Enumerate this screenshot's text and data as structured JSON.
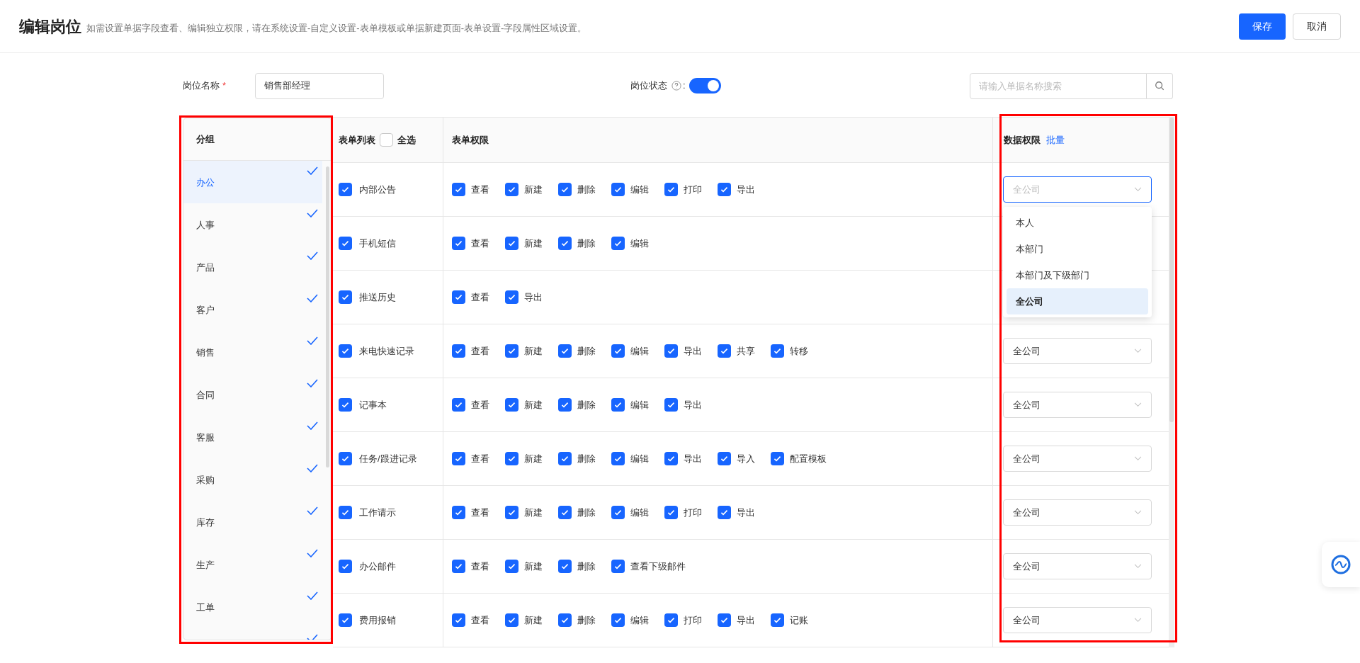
{
  "header": {
    "title": "编辑岗位",
    "hint": "如需设置单据字段查看、编辑独立权限，请在系统设置-自定义设置-表单模板或单据新建页面-表单设置-字段属性区域设置。",
    "buttons": [
      {
        "label": "保存",
        "kind": "primary"
      },
      {
        "label": "取消",
        "kind": "default"
      }
    ]
  },
  "form": {
    "name_label": "岗位名称",
    "required_mark": "*",
    "name_value": "销售部经理",
    "status_label": "岗位状态",
    "status_suffix": ":",
    "status_on": true,
    "search_placeholder": "请输入单据名称搜索"
  },
  "groups": {
    "heading": "分组",
    "items": [
      {
        "label": "办公",
        "checked": true,
        "selected": true
      },
      {
        "label": "人事",
        "checked": true,
        "selected": false
      },
      {
        "label": "产品",
        "checked": true,
        "selected": false
      },
      {
        "label": "客户",
        "checked": true,
        "selected": false
      },
      {
        "label": "销售",
        "checked": true,
        "selected": false
      },
      {
        "label": "合同",
        "checked": true,
        "selected": false
      },
      {
        "label": "客服",
        "checked": true,
        "selected": false
      },
      {
        "label": "采购",
        "checked": true,
        "selected": false
      },
      {
        "label": "库存",
        "checked": true,
        "selected": false
      },
      {
        "label": "生产",
        "checked": true,
        "selected": false
      },
      {
        "label": "工单",
        "checked": true,
        "selected": false
      },
      {
        "checked": true,
        "selected": false
      }
    ]
  },
  "table": {
    "form_heading": "表单列表",
    "select_all_label": "全选",
    "select_all_checked": false,
    "perm_heading": "表单权限",
    "data_heading": "数据权限",
    "batch_link": "批量",
    "rows": [
      {
        "name": "内部公告",
        "checked": true,
        "perms": [
          {
            "label": "查看",
            "checked": true
          },
          {
            "label": "新建",
            "checked": true
          },
          {
            "label": "删除",
            "checked": true
          },
          {
            "label": "编辑",
            "checked": true
          },
          {
            "label": "打印",
            "checked": true
          },
          {
            "label": "导出",
            "checked": true
          }
        ],
        "scope": "全公司",
        "open": true
      },
      {
        "name": "手机短信",
        "checked": true,
        "perms": [
          {
            "label": "查看",
            "checked": true
          },
          {
            "label": "新建",
            "checked": true
          },
          {
            "label": "删除",
            "checked": true
          },
          {
            "label": "编辑",
            "checked": true
          }
        ]
      },
      {
        "name": "推送历史",
        "checked": true,
        "perms": [
          {
            "label": "查看",
            "checked": true
          },
          {
            "label": "导出",
            "checked": true
          }
        ]
      },
      {
        "name": "来电快速记录",
        "checked": true,
        "perms": [
          {
            "label": "查看",
            "checked": true
          },
          {
            "label": "新建",
            "checked": true
          },
          {
            "label": "删除",
            "checked": true
          },
          {
            "label": "编辑",
            "checked": true
          },
          {
            "label": "导出",
            "checked": true
          },
          {
            "label": "共享",
            "checked": true
          },
          {
            "label": "转移",
            "checked": true
          }
        ],
        "scope": "全公司",
        "open": false
      },
      {
        "name": "记事本",
        "checked": true,
        "perms": [
          {
            "label": "查看",
            "checked": true
          },
          {
            "label": "新建",
            "checked": true
          },
          {
            "label": "删除",
            "checked": true
          },
          {
            "label": "编辑",
            "checked": true
          },
          {
            "label": "导出",
            "checked": true
          }
        ],
        "scope": "全公司",
        "open": false
      },
      {
        "name": "任务/跟进记录",
        "checked": true,
        "perms": [
          {
            "label": "查看",
            "checked": true
          },
          {
            "label": "新建",
            "checked": true
          },
          {
            "label": "删除",
            "checked": true
          },
          {
            "label": "编辑",
            "checked": true
          },
          {
            "label": "导出",
            "checked": true
          },
          {
            "label": "导入",
            "checked": true
          },
          {
            "label": "配置模板",
            "checked": true
          }
        ],
        "scope": "全公司",
        "open": false
      },
      {
        "name": "工作请示",
        "checked": true,
        "perms": [
          {
            "label": "查看",
            "checked": true
          },
          {
            "label": "新建",
            "checked": true
          },
          {
            "label": "删除",
            "checked": true
          },
          {
            "label": "编辑",
            "checked": true
          },
          {
            "label": "打印",
            "checked": true
          },
          {
            "label": "导出",
            "checked": true
          }
        ],
        "scope": "全公司",
        "open": false
      },
      {
        "name": "办公邮件",
        "checked": true,
        "perms": [
          {
            "label": "查看",
            "checked": true
          },
          {
            "label": "新建",
            "checked": true
          },
          {
            "label": "删除",
            "checked": true
          },
          {
            "label": "查看下级邮件",
            "checked": true
          }
        ],
        "scope": "全公司",
        "open": false
      },
      {
        "name": "费用报销",
        "checked": true,
        "perms": [
          {
            "label": "查看",
            "checked": true
          },
          {
            "label": "新建",
            "checked": true
          },
          {
            "label": "删除",
            "checked": true
          },
          {
            "label": "编辑",
            "checked": true
          },
          {
            "label": "打印",
            "checked": true
          },
          {
            "label": "导出",
            "checked": true
          },
          {
            "label": "记账",
            "checked": true
          }
        ],
        "scope": "全公司",
        "open": false
      }
    ]
  },
  "dropdown": {
    "options": [
      {
        "label": "本人",
        "selected": false
      },
      {
        "label": "本部门",
        "selected": false
      },
      {
        "label": "本部门及下级部门",
        "selected": false
      },
      {
        "label": "全公司",
        "selected": true
      }
    ]
  }
}
